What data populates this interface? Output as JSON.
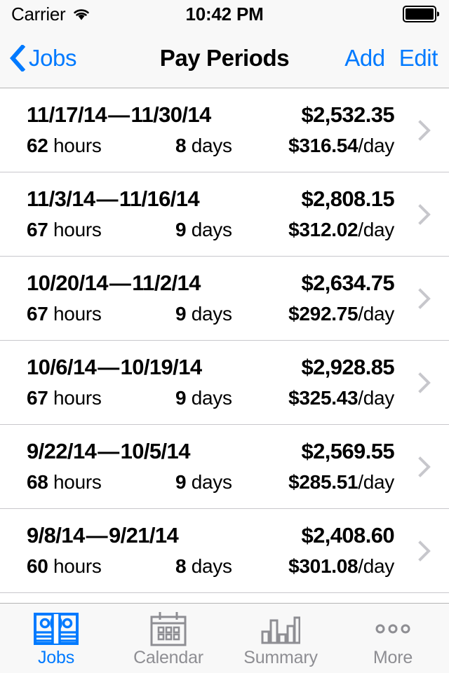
{
  "status_bar": {
    "carrier": "Carrier",
    "wifi_icon": "wifi-icon",
    "time": "10:42 PM",
    "battery_icon": "battery-full-icon"
  },
  "nav_bar": {
    "back_icon": "chevron-left-icon",
    "back_label": "Jobs",
    "title": "Pay Periods",
    "add_label": "Add",
    "edit_label": "Edit"
  },
  "colors": {
    "accent": "#007aff",
    "inactive": "#8e8e93",
    "separator": "#c8c7cc",
    "bar_background": "#f8f8f8",
    "text": "#000000"
  },
  "pay_periods": [
    {
      "range": "11/17/14 — 11/30/14",
      "total": "$2,532.35",
      "hours_value": "62",
      "hours_unit": "hours",
      "days_value": "8",
      "days_unit": "days",
      "rate_value": "$316.54",
      "rate_unit": "/day",
      "disclosure_icon": "chevron-right-icon"
    },
    {
      "range": "11/3/14 — 11/16/14",
      "total": "$2,808.15",
      "hours_value": "67",
      "hours_unit": "hours",
      "days_value": "9",
      "days_unit": "days",
      "rate_value": "$312.02",
      "rate_unit": "/day",
      "disclosure_icon": "chevron-right-icon"
    },
    {
      "range": "10/20/14 — 11/2/14",
      "total": "$2,634.75",
      "hours_value": "67",
      "hours_unit": "hours",
      "days_value": "9",
      "days_unit": "days",
      "rate_value": "$292.75",
      "rate_unit": "/day",
      "disclosure_icon": "chevron-right-icon"
    },
    {
      "range": "10/6/14 — 10/19/14",
      "total": "$2,928.85",
      "hours_value": "67",
      "hours_unit": "hours",
      "days_value": "9",
      "days_unit": "days",
      "rate_value": "$325.43",
      "rate_unit": "/day",
      "disclosure_icon": "chevron-right-icon"
    },
    {
      "range": "9/22/14 — 10/5/14",
      "total": "$2,569.55",
      "hours_value": "68",
      "hours_unit": "hours",
      "days_value": "9",
      "days_unit": "days",
      "rate_value": "$285.51",
      "rate_unit": "/day",
      "disclosure_icon": "chevron-right-icon"
    },
    {
      "range": "9/8/14 — 9/21/14",
      "total": "$2,408.60",
      "hours_value": "60",
      "hours_unit": "hours",
      "days_value": "8",
      "days_unit": "days",
      "rate_value": "$301.08",
      "rate_unit": "/day",
      "disclosure_icon": "chevron-right-icon"
    }
  ],
  "tab_bar": {
    "items": [
      {
        "label": "Jobs",
        "icon": "banknotes-icon",
        "active": true
      },
      {
        "label": "Calendar",
        "icon": "calendar-icon",
        "active": false
      },
      {
        "label": "Summary",
        "icon": "bar-chart-icon",
        "active": false
      },
      {
        "label": "More",
        "icon": "ellipsis-icon",
        "active": false
      }
    ]
  }
}
